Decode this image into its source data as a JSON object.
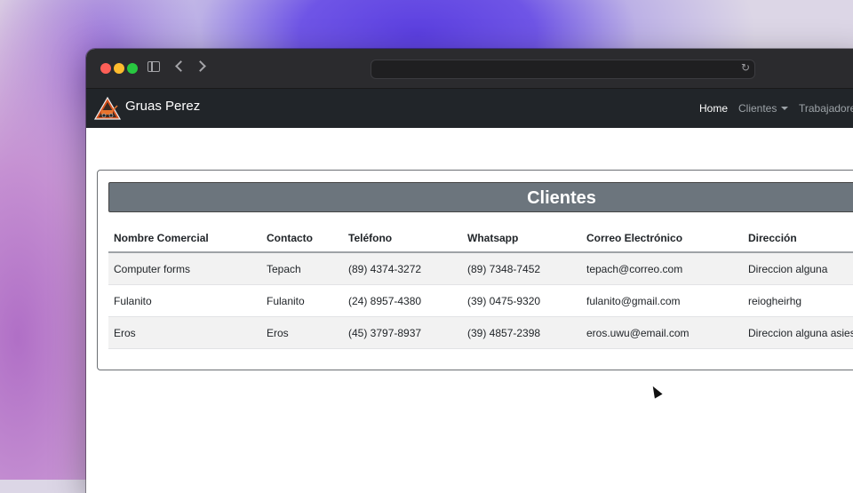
{
  "browser": {
    "url": ""
  },
  "navbar": {
    "brand": "Gruas Perez",
    "links": [
      "Home",
      "Clientes",
      "Trabajadore"
    ]
  },
  "card": {
    "title": "Clientes"
  },
  "table": {
    "headers": [
      "Nombre Comercial",
      "Contacto",
      "Teléfono",
      "Whatsapp",
      "Correo Electrónico",
      "Dirección"
    ],
    "rows": [
      [
        "Computer forms",
        "Tepach",
        "(89) 4374-3272",
        "(89) 7348-7452",
        "tepach@correo.com",
        "Direccion alguna"
      ],
      [
        "Fulanito",
        "Fulanito",
        "(24) 8957-4380",
        "(39) 0475-9320",
        "fulanito@gmail.com",
        "reiogheirhg"
      ],
      [
        "Eros",
        "Eros",
        "(45) 3797-8937",
        "(39) 4857-2398",
        "eros.uwu@email.com",
        "Direccion alguna asies"
      ]
    ]
  },
  "colors": {
    "navbar_bg": "#212529",
    "title_bg": "#6c757d"
  }
}
